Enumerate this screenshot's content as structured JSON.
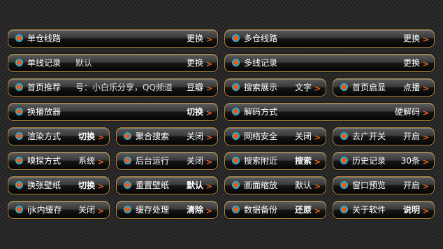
{
  "arrow": ">",
  "rows": [
    {
      "single_route": {
        "label": "单仓线路",
        "value": "更换"
      },
      "multi_route": {
        "label": "多仓线路",
        "value": "更换"
      }
    },
    {
      "single_record": {
        "label": "单线记录",
        "default": "默认",
        "value": "更换"
      },
      "multi_record": {
        "label": "多线记录",
        "value": "更换"
      }
    },
    {
      "home_recommend": {
        "label": "首页推荐",
        "text": "号：小白乐分享，QQ频道",
        "value": "豆瓣"
      },
      "search_display": {
        "label": "搜索展示",
        "value": "文字"
      },
      "home_startup": {
        "label": "首页启显",
        "value": "点播"
      }
    },
    {
      "switch_player": {
        "label": "换播放器",
        "value": "切换"
      },
      "decode_mode": {
        "label": "解码方式",
        "value": "硬解码"
      }
    },
    {
      "render_mode": {
        "label": "渲染方式",
        "value": "切换"
      },
      "aggregate_search": {
        "label": "聚合搜索",
        "value": "关闭"
      },
      "network_security": {
        "label": "网络安全",
        "value": "关闭"
      },
      "ad_switch": {
        "label": "去广开关",
        "value": "开启"
      }
    },
    {
      "sniff_mode": {
        "label": "嗅探方式",
        "value": "系统"
      },
      "background_run": {
        "label": "后台运行",
        "value": "关闭"
      },
      "search_nearby": {
        "label": "搜索附近",
        "value": "搜索"
      },
      "history": {
        "label": "历史记录",
        "value": "30条"
      }
    },
    {
      "change_wallpaper": {
        "label": "换张壁纸",
        "value": "切换"
      },
      "reset_wallpaper": {
        "label": "重置壁纸",
        "value": "默认"
      },
      "screen_scale": {
        "label": "画面缩放",
        "value": "默认"
      },
      "window_preview": {
        "label": "窗口预览",
        "value": "开启"
      }
    },
    {
      "ijk_cache": {
        "label": "ijk内缓存",
        "value": "关闭"
      },
      "cache_handle": {
        "label": "缓存处理",
        "value": "清除"
      },
      "data_backup": {
        "label": "数据备份",
        "value": "还原"
      },
      "about": {
        "label": "关于软件",
        "value": "说明"
      }
    }
  ]
}
